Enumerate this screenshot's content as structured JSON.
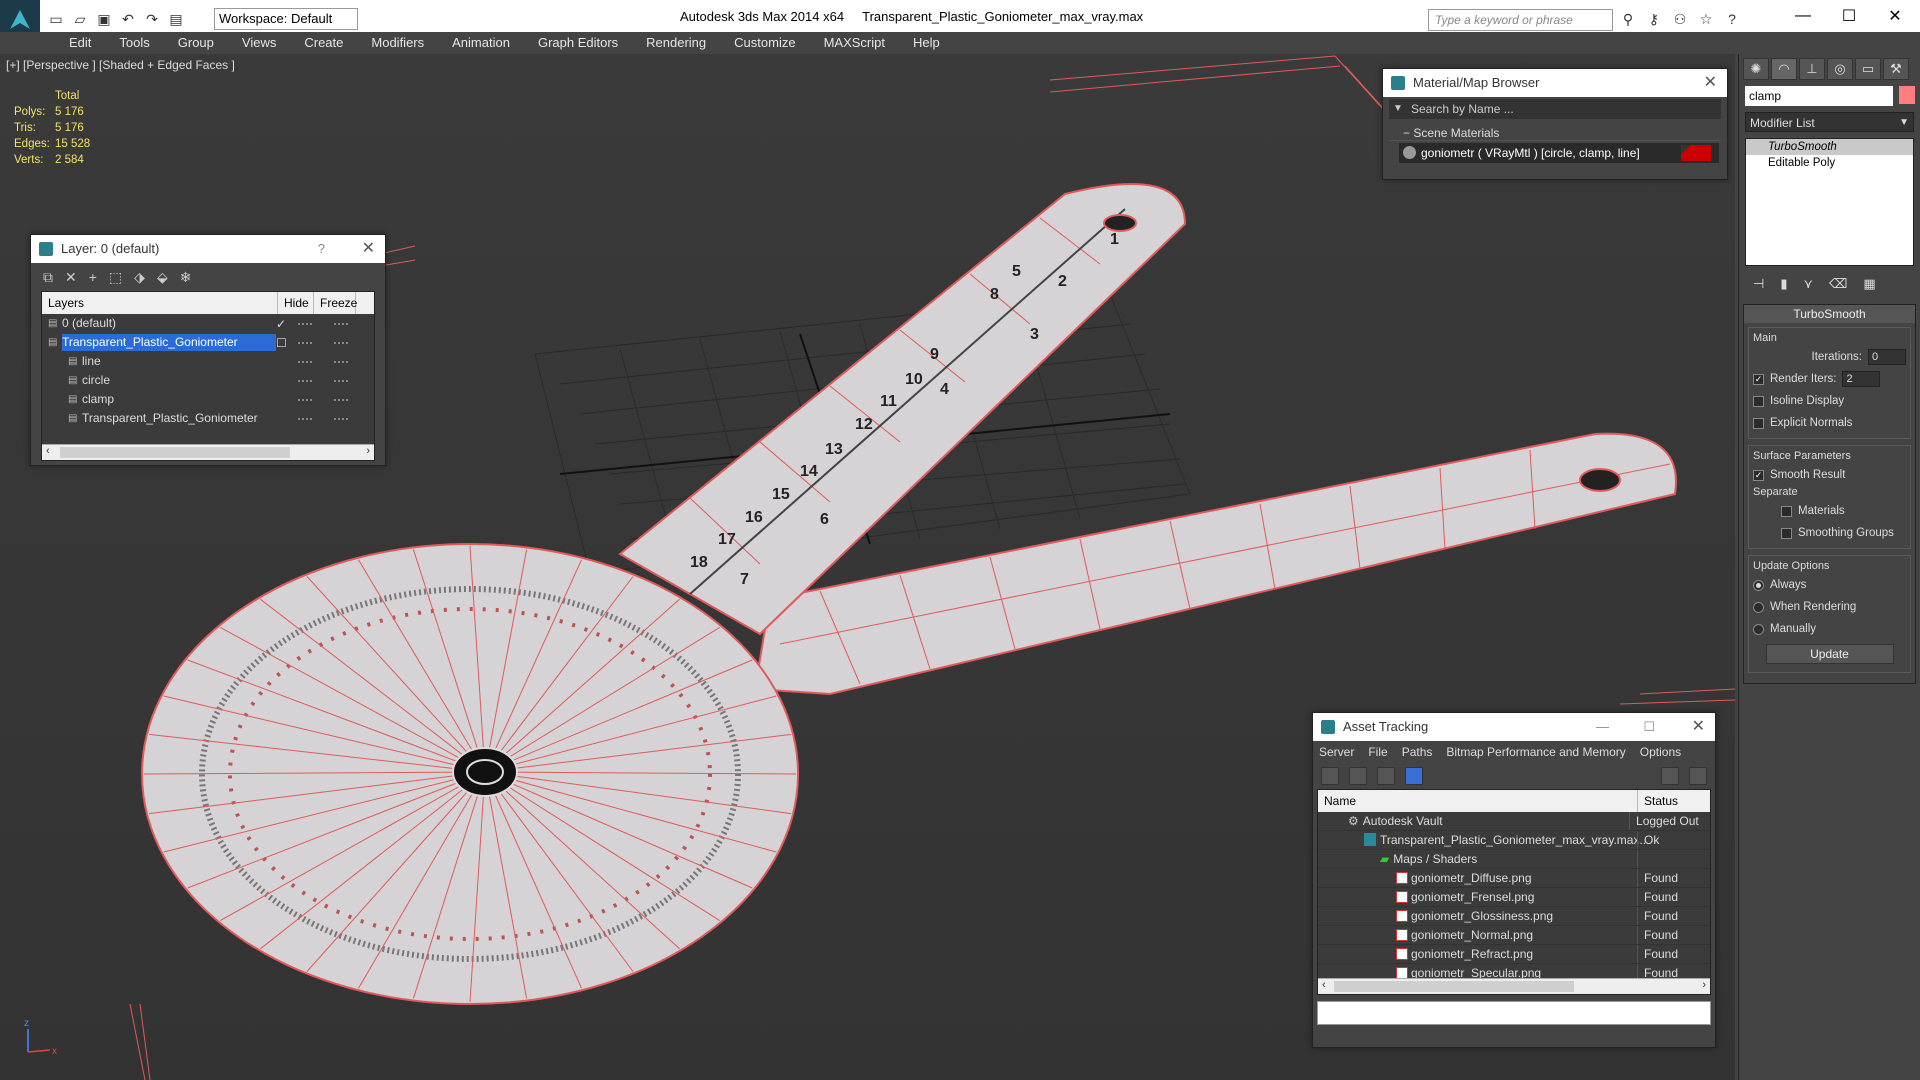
{
  "app": {
    "title": "Autodesk 3ds Max  2014 x64",
    "file": "Transparent_Plastic_Goniometer_max_vray.max",
    "workspace": "Workspace: Default",
    "search_placeholder": "Type a keyword or phrase"
  },
  "menu": [
    "Edit",
    "Tools",
    "Group",
    "Views",
    "Create",
    "Modifiers",
    "Animation",
    "Graph Editors",
    "Rendering",
    "Customize",
    "MAXScript",
    "Help"
  ],
  "viewport": {
    "label": "[+] [Perspective ] [Shaded + Edged Faces ]",
    "stats": {
      "header": "Total",
      "rows": [
        {
          "k": "Polys:",
          "v": "5 176"
        },
        {
          "k": "Tris:",
          "v": "5 176"
        },
        {
          "k": "Edges:",
          "v": "15 528"
        },
        {
          "k": "Verts:",
          "v": "2 584"
        }
      ]
    },
    "ruler_numbers": [
      "1",
      "2",
      "3",
      "4",
      "5",
      "6",
      "7",
      "8",
      "9",
      "10",
      "11",
      "12",
      "13",
      "14",
      "15",
      "16",
      "17",
      "18"
    ],
    "axis": {
      "x": "x",
      "z": "z"
    }
  },
  "layer_panel": {
    "title": "Layer: 0 (default)",
    "help": "?",
    "col_layers": "Layers",
    "col_hide": "Hide",
    "col_freeze": "Freeze",
    "rows": [
      {
        "name": "0 (default)",
        "indent": 1,
        "selected": false,
        "check": true
      },
      {
        "name": "Transparent_Plastic_Goniometer",
        "indent": 1,
        "selected": true,
        "check": false
      },
      {
        "name": "line",
        "indent": 2,
        "selected": false,
        "check": false
      },
      {
        "name": "circle",
        "indent": 2,
        "selected": false,
        "check": false
      },
      {
        "name": "clamp",
        "indent": 2,
        "selected": false,
        "check": false
      },
      {
        "name": "Transparent_Plastic_Goniometer",
        "indent": 2,
        "selected": false,
        "check": false
      }
    ]
  },
  "material_browser": {
    "title": "Material/Map Browser",
    "search": "Search by Name ...",
    "section": "Scene Materials",
    "material": "goniometr  ( VRayMtl )  [circle, clamp, line]"
  },
  "asset_tracking": {
    "title": "Asset Tracking",
    "menus": [
      "Server",
      "File",
      "Paths",
      "Bitmap Performance and Memory",
      "Options"
    ],
    "col_name": "Name",
    "col_status": "Status",
    "rows": [
      {
        "name": "Autodesk Vault",
        "status": "Logged Out ...",
        "indent": 0,
        "kind": "vault"
      },
      {
        "name": "Transparent_Plastic_Goniometer_max_vray.max",
        "status": "Ok",
        "indent": 1,
        "kind": "max"
      },
      {
        "name": "Maps / Shaders",
        "status": "",
        "indent": 2,
        "kind": "folder"
      },
      {
        "name": "goniometr_Diffuse.png",
        "status": "Found",
        "indent": 3,
        "kind": "png"
      },
      {
        "name": "goniometr_Frensel.png",
        "status": "Found",
        "indent": 3,
        "kind": "png"
      },
      {
        "name": "goniometr_Glossiness.png",
        "status": "Found",
        "indent": 3,
        "kind": "png"
      },
      {
        "name": "goniometr_Normal.png",
        "status": "Found",
        "indent": 3,
        "kind": "png"
      },
      {
        "name": "goniometr_Refract.png",
        "status": "Found",
        "indent": 3,
        "kind": "png"
      },
      {
        "name": "goniometr_Specular.png",
        "status": "Found",
        "indent": 3,
        "kind": "png"
      }
    ]
  },
  "command_panel": {
    "object_name": "clamp",
    "object_color": "#ff7f7f",
    "modifier_list": "Modifier List",
    "stack": [
      "TurboSmooth",
      "Editable Poly"
    ],
    "rollout_title": "TurboSmooth",
    "main_label": "Main",
    "iterations_label": "Iterations:",
    "iterations_value": "0",
    "render_iters_label": "Render Iters:",
    "render_iters_value": "2",
    "isoline": "Isoline Display",
    "explicit": "Explicit Normals",
    "surface_label": "Surface Parameters",
    "smooth_result": "Smooth Result",
    "separate_label": "Separate",
    "materials": "Materials",
    "smoothing_groups": "Smoothing Groups",
    "update_label": "Update Options",
    "always": "Always",
    "when_rendering": "When Rendering",
    "manually": "Manually",
    "update_button": "Update"
  },
  "colors": {
    "wire": "#e05a5a",
    "mesh": "#d5d3d6",
    "accent": "#2b6bd6"
  }
}
